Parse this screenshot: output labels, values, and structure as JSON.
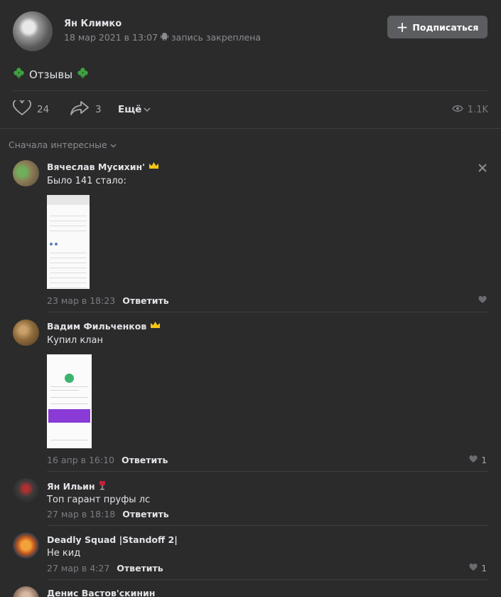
{
  "post": {
    "author": "Ян Климко",
    "date": "18 мар 2021 в 13:07",
    "pinned_note": "запись закреплена",
    "subscribe_label": "Подписаться",
    "text": "Отзывы",
    "likes": "24",
    "shares": "3",
    "more_label": "Ещё",
    "views": "1.1K"
  },
  "comments_sort": "Сначала интересные",
  "comments": [
    {
      "author": "Вячеслав Мусихин'",
      "text": "Было 141 стало:",
      "date": "23 мар в 18:23",
      "reply_label": "Ответить",
      "likes": ""
    },
    {
      "author": "Вадим Фильченков",
      "text": "Купил клан",
      "date": "16 апр в 16:10",
      "reply_label": "Ответить",
      "likes": "1"
    },
    {
      "author": "Ян Ильин",
      "text": "Топ гарант пруфы лс",
      "date": "27 мар в 18:18",
      "reply_label": "Ответить",
      "likes": ""
    },
    {
      "author": "Deadly Squad |Standoff 2|",
      "text": "Не кид",
      "date": "27 мар в 4:27",
      "reply_label": "Ответить",
      "likes": "1"
    },
    {
      "author": "Денис Вастов'скинин",
      "text": "",
      "date": "",
      "reply_label": "",
      "likes": ""
    }
  ],
  "colors": {
    "background": "#2b2b2c",
    "button": "#5c5d60",
    "text": "#e1e3e6",
    "muted": "#7b7d81",
    "crown": "#f5c518"
  },
  "icons": [
    "clover-icon",
    "android-icon",
    "heart-icon",
    "share-icon",
    "chevron-down-icon",
    "eye-icon",
    "close-icon",
    "crown-icon",
    "wine-icon"
  ]
}
